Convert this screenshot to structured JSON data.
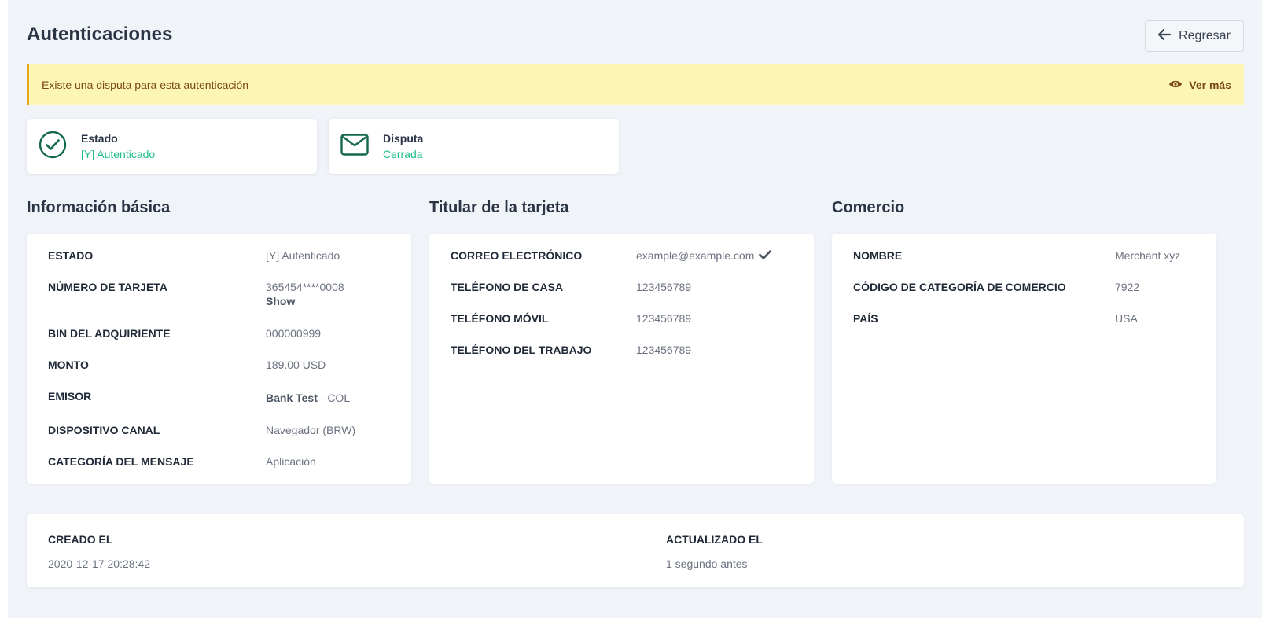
{
  "header": {
    "title": "Autenticaciones",
    "back_label": "Regresar"
  },
  "alert": {
    "message": "Existe una disputa para esta autenticación",
    "action_label": "Ver más"
  },
  "status_cards": [
    {
      "label": "Estado",
      "value": "[Y] Autenticado",
      "icon": "check-circle-icon"
    },
    {
      "label": "Disputa",
      "value": "Cerrada",
      "icon": "envelope-icon"
    }
  ],
  "basic_info": {
    "title": "Información básica",
    "rows": [
      {
        "key": "ESTADO",
        "value": "[Y] Autenticado"
      },
      {
        "key": "NÚMERO DE TARJETA",
        "value": "365454****0008",
        "link": "Show"
      },
      {
        "key": "BIN DEL ADQUIRIENTE",
        "value": "000000999"
      },
      {
        "key": "MONTO",
        "value": "189.00 USD"
      },
      {
        "key": "EMISOR",
        "value_bold": "Bank Test",
        "value": " - COL"
      },
      {
        "key": "DISPOSITIVO CANAL",
        "value": "Navegador (BRW)"
      },
      {
        "key": "CATEGORÍA DEL MENSAJE",
        "value": "Aplicación"
      }
    ]
  },
  "cardholder": {
    "title": "Titular de la tarjeta",
    "rows": [
      {
        "key": "CORREO ELECTRÓNICO",
        "value": "example@example.com",
        "icon": "check-icon"
      },
      {
        "key": "TELÉFONO DE CASA",
        "value": "123456789"
      },
      {
        "key": "TELÉFONO MÓVIL",
        "value": "123456789"
      },
      {
        "key": "TELÉFONO DEL TRABAJO",
        "value": "123456789"
      }
    ]
  },
  "merchant": {
    "title": "Comercio",
    "rows": [
      {
        "key": "NOMBRE",
        "value": "Merchant xyz"
      },
      {
        "key": "CÓDIGO DE CATEGORÍA DE COMERCIO",
        "value": "7922"
      },
      {
        "key": "PAÍS",
        "value": "USA"
      }
    ]
  },
  "footer": {
    "created_label": "CREADO EL",
    "created_value": "2020-12-17 20:28:42",
    "updated_label": "ACTUALIZADO EL",
    "updated_value": "1 segundo antes"
  },
  "colors": {
    "accent_green": "#1fbf87",
    "icon_green": "#14684e",
    "alert_bg": "#fdf5b6",
    "alert_border": "#e6a817"
  }
}
